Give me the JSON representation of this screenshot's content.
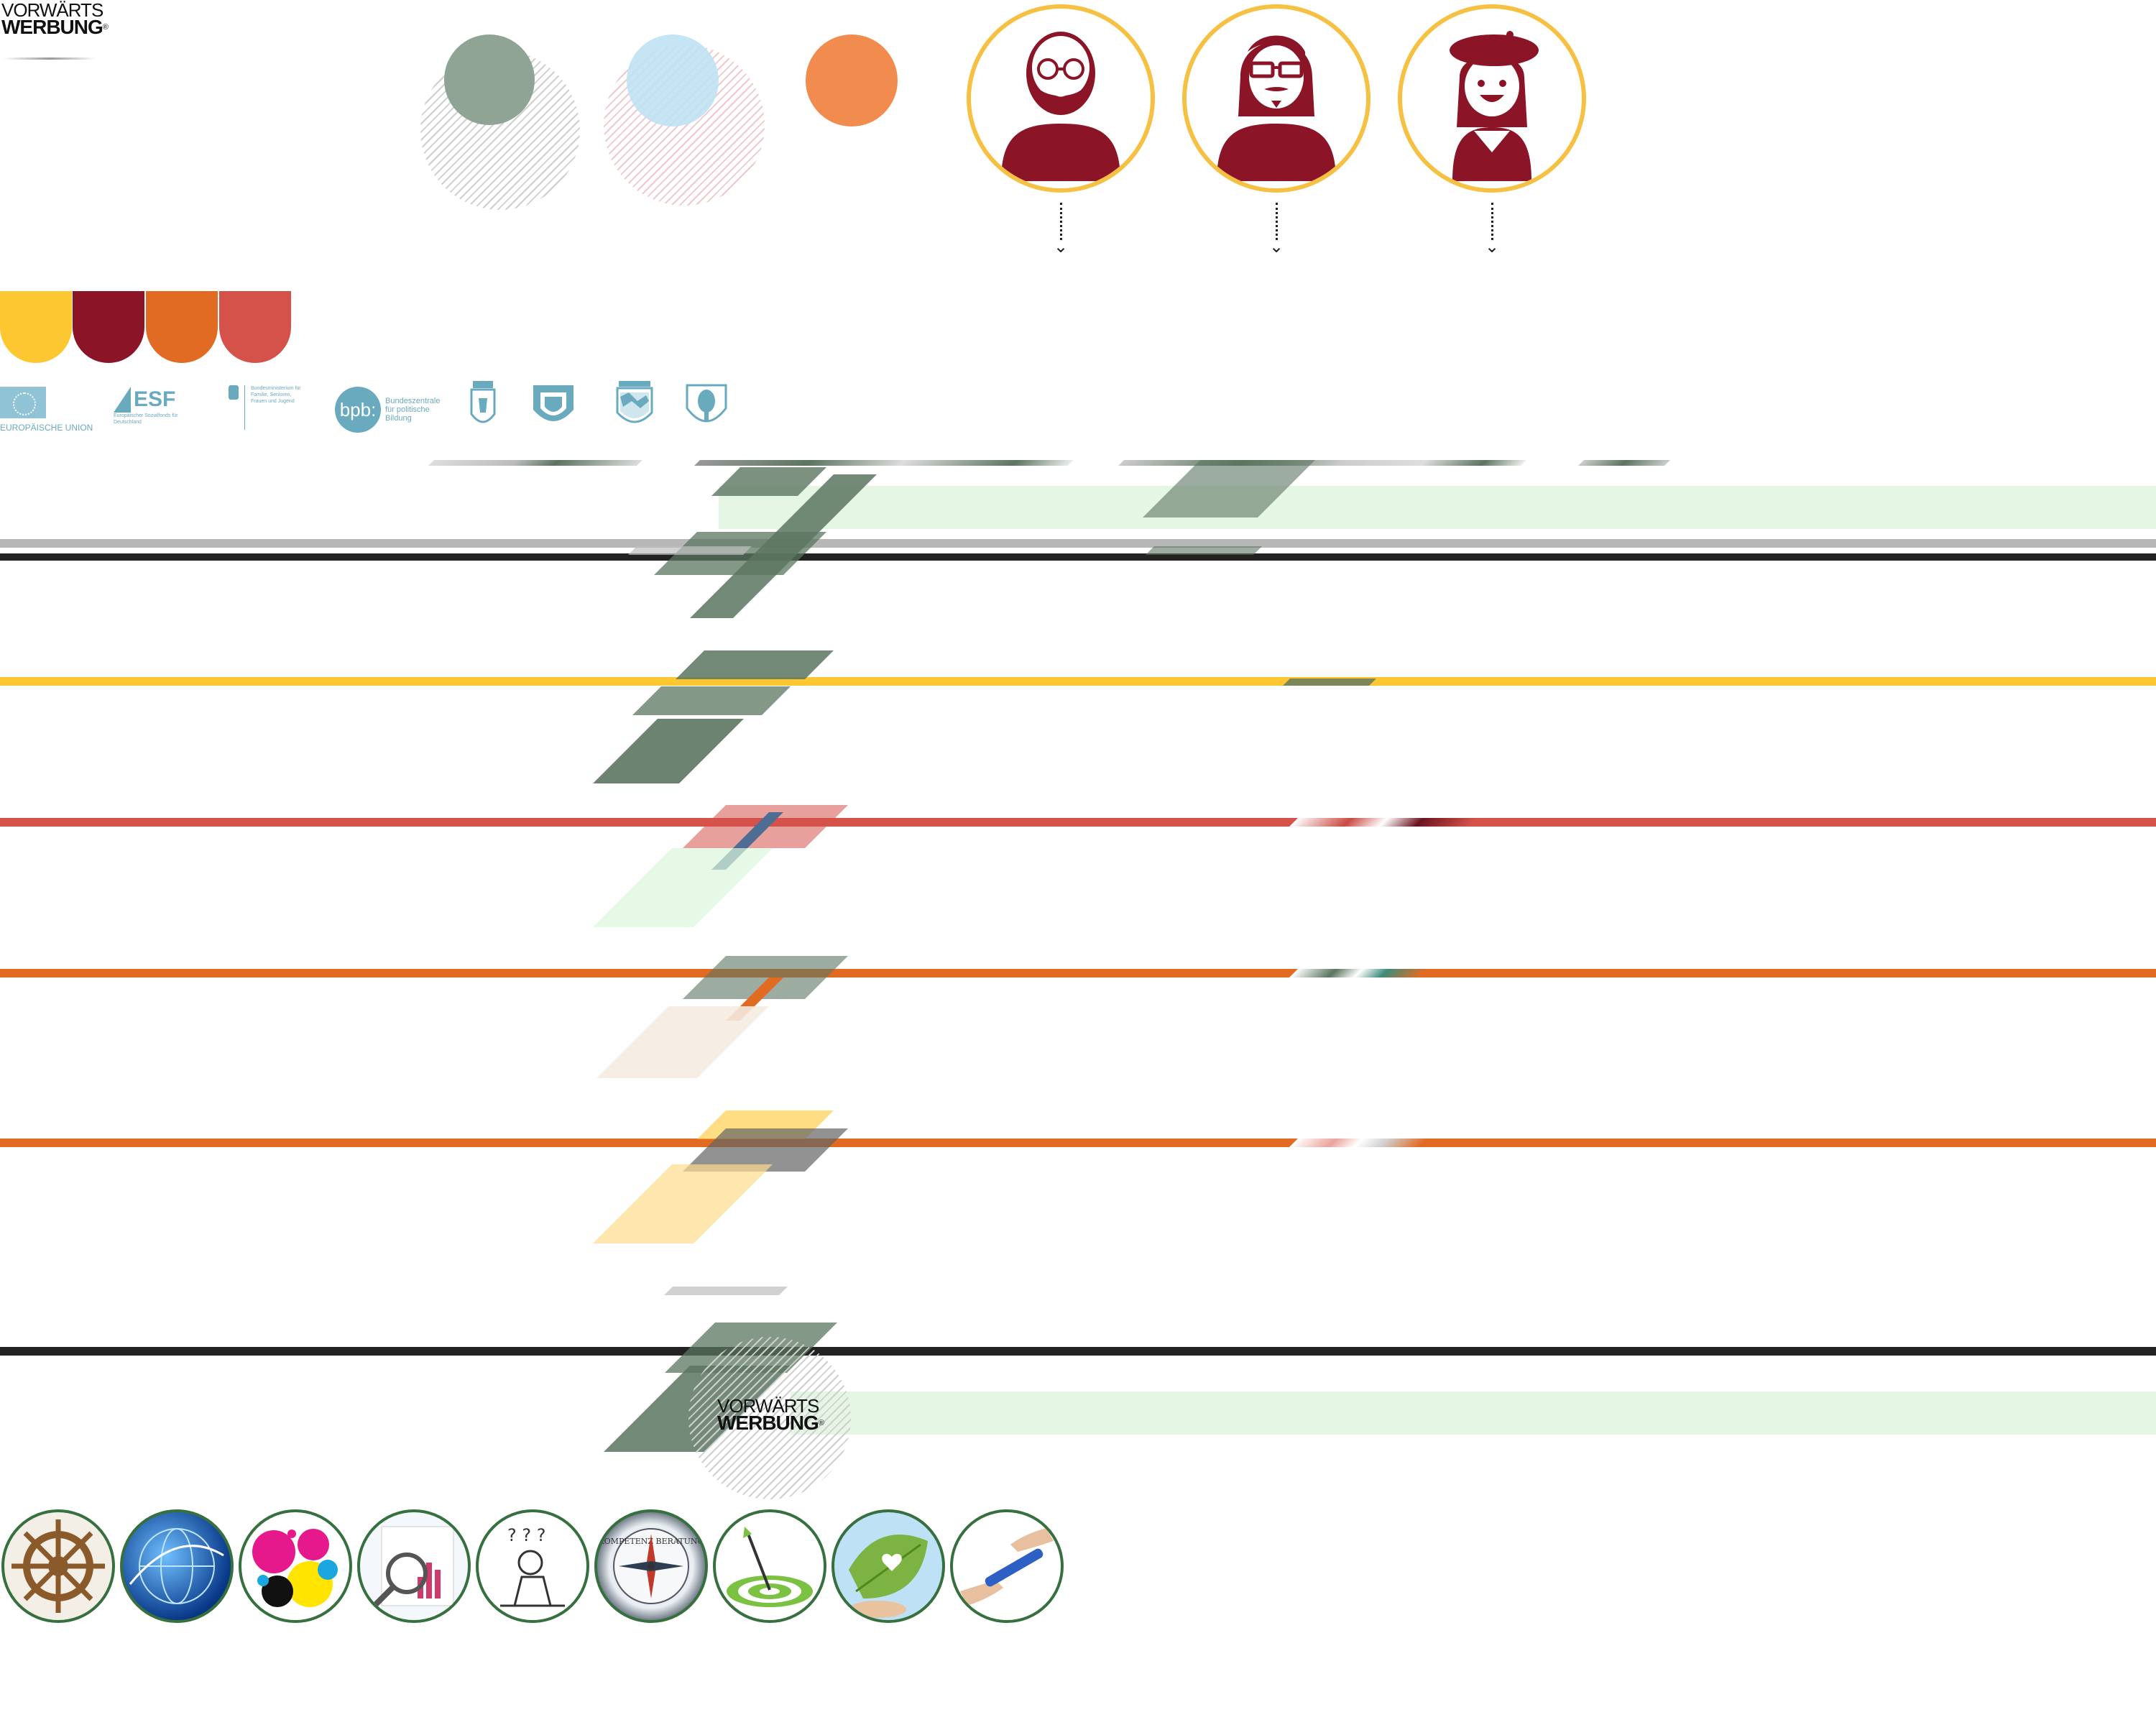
{
  "brand": {
    "logo_line1": "VORWÄRTS",
    "logo_line2": "WERBUNG",
    "registered_mark": "®"
  },
  "colors": {
    "yellow": "#fdc731",
    "bordeaux": "#8b1427",
    "orange": "#e26b24",
    "coral": "#d5524a",
    "sage": "#5b7560",
    "sky": "#a8d8ef",
    "peach": "#f28b4e",
    "ring": "#f6c142",
    "mint": "#e5f7e4",
    "sponsor_blue": "#6aaabf"
  },
  "sponsors": {
    "eu_label": "EUROPÄISCHE UNION",
    "esf_label": "ESF",
    "esf_sub": "Europäischer Sozialfonds für Deutschland",
    "ministry_label": "Bundesministerium für Familie, Senioren, Frauen und Jugend",
    "bpb_label": "bpb:",
    "bpb_sub": "Bundeszentrale für politische Bildung"
  },
  "avatars": [
    {
      "icon": "bald-man-glasses-icon"
    },
    {
      "icon": "man-glasses-long-hair-icon"
    },
    {
      "icon": "woman-beret-icon"
    }
  ],
  "topic_icons": [
    "ship-wheel-icon",
    "globe-network-icon",
    "paint-splash-icon",
    "magnifier-chart-icon",
    "confused-person-icon",
    "compass-icon",
    "target-dart-icon",
    "leaf-heart-icon",
    "relay-baton-icon"
  ],
  "compass_text": "KOMPETENZ BERATUNG"
}
